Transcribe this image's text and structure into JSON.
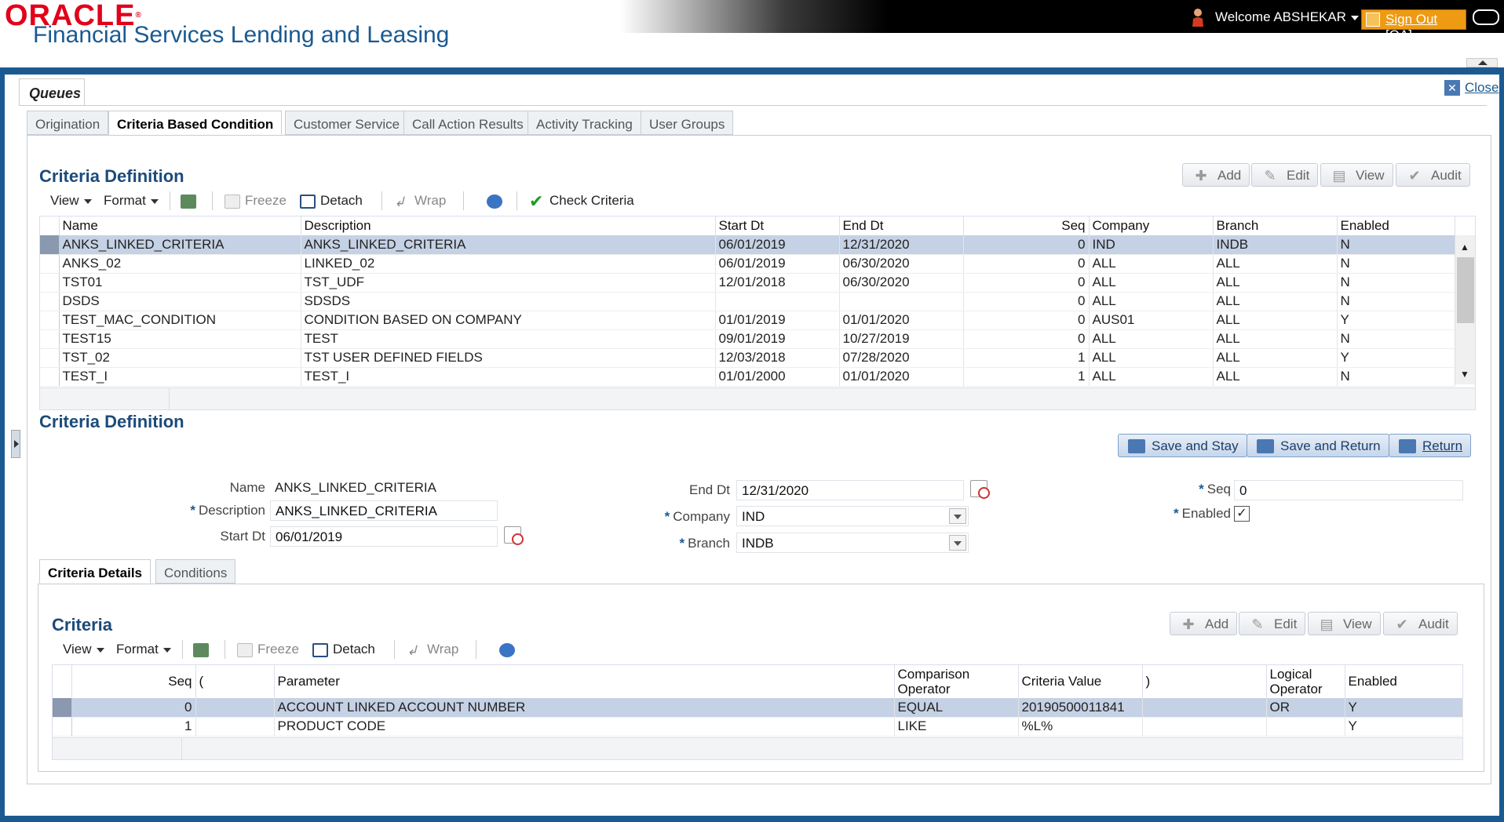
{
  "header": {
    "logo_text": "ORACLE",
    "app_title": "Financial Services Lending and Leasing",
    "welcome": "Welcome ABSHEKAR",
    "sign_out": "Sign Out [QA]"
  },
  "queues_tab": "Queues",
  "close_label": "Close",
  "tabs": [
    "Origination",
    "Criteria Based Condition",
    "Customer Service",
    "Call Action Results",
    "Activity Tracking",
    "User Groups"
  ],
  "active_tab": "Criteria Based Condition",
  "criteria_list": {
    "title": "Criteria Definition",
    "toolbar": {
      "view": "View",
      "format": "Format",
      "freeze": "Freeze",
      "detach": "Detach",
      "wrap": "Wrap",
      "check_criteria": "Check Criteria"
    },
    "buttons": {
      "add": "Add",
      "edit": "Edit",
      "view": "View",
      "audit": "Audit"
    },
    "columns": [
      "Name",
      "Description",
      "Start Dt",
      "End Dt",
      "Seq",
      "Company",
      "Branch",
      "Enabled"
    ],
    "rows": [
      [
        "ANKS_LINKED_CRITERIA",
        "ANKS_LINKED_CRITERIA",
        "06/01/2019",
        "12/31/2020",
        "0",
        "IND",
        "INDB",
        "N"
      ],
      [
        "ANKS_02",
        "LINKED_02",
        "06/01/2019",
        "06/30/2020",
        "0",
        "ALL",
        "ALL",
        "N"
      ],
      [
        "TST01",
        "TST_UDF",
        "12/01/2018",
        "06/30/2020",
        "0",
        "ALL",
        "ALL",
        "N"
      ],
      [
        "DSDS",
        "SDSDS",
        "",
        "",
        "0",
        "ALL",
        "ALL",
        "N"
      ],
      [
        "TEST_MAC_CONDITION",
        "CONDITION BASED ON COMPANY",
        "01/01/2019",
        "01/01/2020",
        "0",
        "AUS01",
        "ALL",
        "Y"
      ],
      [
        "TEST15",
        "TEST",
        "09/01/2019",
        "10/27/2019",
        "0",
        "ALL",
        "ALL",
        "N"
      ],
      [
        "TST_02",
        "TST USER DEFINED FIELDS",
        "12/03/2018",
        "07/28/2020",
        "1",
        "ALL",
        "ALL",
        "Y"
      ],
      [
        "TEST_I",
        "TEST_I",
        "01/01/2000",
        "01/01/2020",
        "1",
        "ALL",
        "ALL",
        "N"
      ]
    ]
  },
  "criteria_form": {
    "title": "Criteria Definition",
    "buttons": {
      "save_stay": "Save and Stay",
      "save_return": "Save and Return",
      "return": "Return"
    },
    "name_label": "Name",
    "name_value": "ANKS_LINKED_CRITERIA",
    "description_label": "Description",
    "description_value": "ANKS_LINKED_CRITERIA",
    "start_label": "Start Dt",
    "start_value": "06/01/2019",
    "end_label": "End Dt",
    "end_value": "12/31/2020",
    "company_label": "Company",
    "company_value": "IND",
    "branch_label": "Branch",
    "branch_value": "INDB",
    "seq_label": "Seq",
    "seq_value": "0",
    "enabled_label": "Enabled",
    "enabled_checked": true,
    "req_mark": "*",
    "check_mark": "✓"
  },
  "sub_tabs": [
    "Criteria Details",
    "Conditions"
  ],
  "criteria_details": {
    "title": "Criteria",
    "toolbar": {
      "view": "View",
      "format": "Format",
      "freeze": "Freeze",
      "detach": "Detach",
      "wrap": "Wrap"
    },
    "buttons": {
      "add": "Add",
      "edit": "Edit",
      "view": "View",
      "audit": "Audit"
    },
    "columns": [
      "Seq",
      "(",
      "Parameter",
      "Comparison Operator",
      "Criteria Value",
      ")",
      "Logical Operator",
      "Enabled"
    ],
    "col_comparison_1": "Comparison",
    "col_comparison_2": "Operator",
    "col_logical_1": "Logical",
    "col_logical_2": "Operator",
    "rows": [
      [
        "0",
        "",
        "ACCOUNT LINKED ACCOUNT NUMBER",
        "EQUAL",
        "20190500011841",
        "",
        "OR",
        "Y"
      ],
      [
        "1",
        "",
        "PRODUCT CODE",
        "LIKE",
        "%L%",
        "",
        "",
        "Y"
      ]
    ]
  }
}
